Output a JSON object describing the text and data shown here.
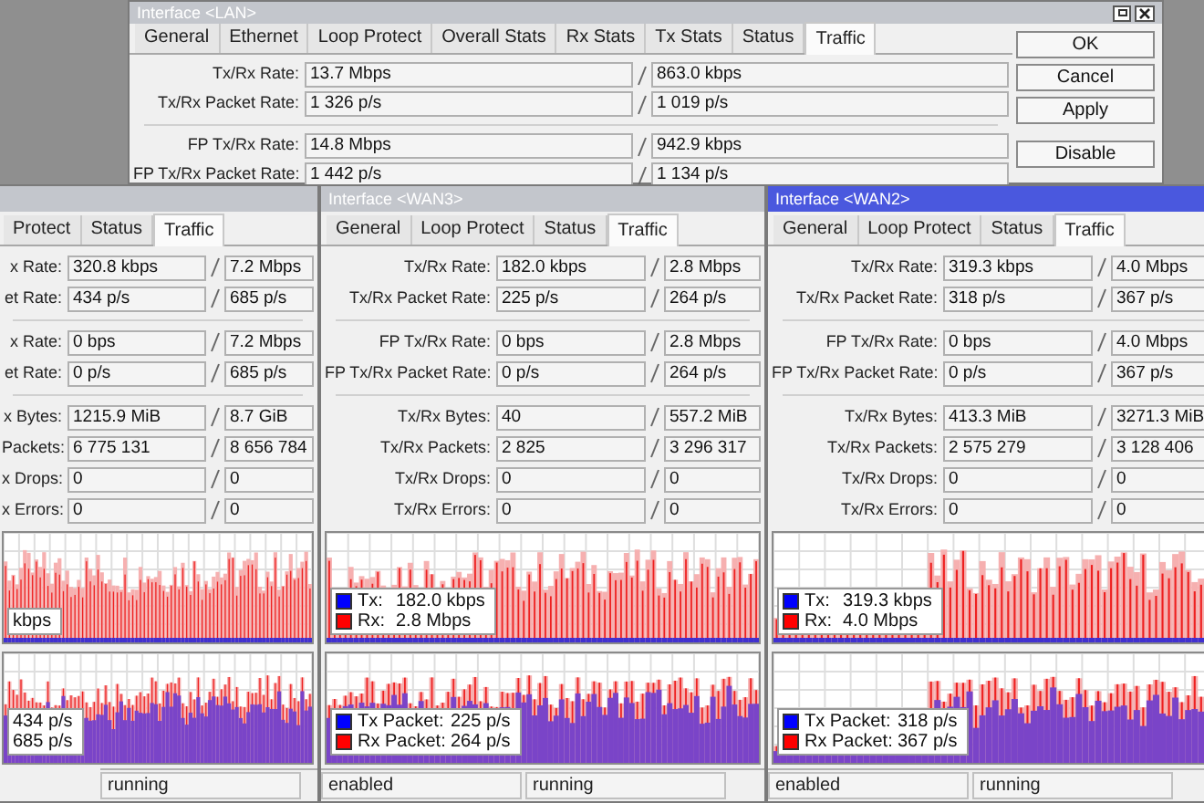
{
  "windows": [
    {
      "title": "Interface <LAN>",
      "active": false,
      "tabs": [
        {
          "label": "General",
          "selected": false
        },
        {
          "label": "Ethernet",
          "selected": false
        },
        {
          "label": "Loop Protect",
          "selected": false
        },
        {
          "label": "Overall Stats",
          "selected": false
        },
        {
          "label": "Rx Stats",
          "selected": false
        },
        {
          "label": "Tx Stats",
          "selected": false
        },
        {
          "label": "Status",
          "selected": false
        },
        {
          "label": "Traffic",
          "selected": true
        }
      ],
      "sections": [
        [
          {
            "label": "Tx/Rx Rate:",
            "tx": "13.7 Mbps",
            "rx": "863.0 kbps"
          },
          {
            "label": "Tx/Rx Packet Rate:",
            "tx": "1 326 p/s",
            "rx": "1 019 p/s"
          }
        ],
        [
          {
            "label": "FP Tx/Rx Rate:",
            "tx": "14.8 Mbps",
            "rx": "942.9 kbps"
          },
          {
            "label": "FP Tx/Rx Packet Rate:",
            "tx": "1 442 p/s",
            "rx": "1 134 p/s"
          }
        ]
      ],
      "buttons": [
        "OK",
        "Cancel",
        "Apply",
        "Disable"
      ]
    },
    {
      "active": false,
      "tabs": [
        {
          "label": "Protect",
          "selected": false
        },
        {
          "label": "Status",
          "selected": false
        },
        {
          "label": "Traffic",
          "selected": true
        }
      ],
      "sections": [
        [
          {
            "label": "x Rate:",
            "tx": "320.8 kbps",
            "rx": "7.2 Mbps"
          },
          {
            "label": "et Rate:",
            "tx": "434 p/s",
            "rx": "685 p/s"
          }
        ],
        [
          {
            "label": "x Rate:",
            "tx": "0 bps",
            "rx": "7.2 Mbps"
          },
          {
            "label": "et Rate:",
            "tx": "0 p/s",
            "rx": "685 p/s"
          }
        ],
        [
          {
            "label": "x Bytes:",
            "tx": "1215.9 MiB",
            "rx": "8.7 GiB"
          },
          {
            "label": "Packets:",
            "tx": "6 775 131",
            "rx": "8 656 784"
          },
          {
            "label": "x Drops:",
            "tx": "0",
            "rx": "0"
          },
          {
            "label": "x Errors:",
            "tx": "0",
            "rx": "0"
          }
        ]
      ],
      "charts": [
        {
          "legend": [
            {
              "value": "kbps"
            }
          ]
        },
        {
          "legend": [
            {
              "value": "434 p/s"
            },
            {
              "value": "685 p/s"
            }
          ]
        }
      ],
      "status": [
        "running"
      ]
    },
    {
      "title": "Interface <WAN3>",
      "active": false,
      "tabs": [
        {
          "label": "General",
          "selected": false
        },
        {
          "label": "Loop Protect",
          "selected": false
        },
        {
          "label": "Status",
          "selected": false
        },
        {
          "label": "Traffic",
          "selected": true
        }
      ],
      "sections": [
        [
          {
            "label": "Tx/Rx Rate:",
            "tx": "182.0 kbps",
            "rx": "2.8 Mbps"
          },
          {
            "label": "Tx/Rx Packet Rate:",
            "tx": "225 p/s",
            "rx": "264 p/s"
          }
        ],
        [
          {
            "label": "FP Tx/Rx Rate:",
            "tx": "0 bps",
            "rx": "2.8 Mbps"
          },
          {
            "label": "FP Tx/Rx Packet Rate:",
            "tx": "0 p/s",
            "rx": "264 p/s"
          }
        ],
        [
          {
            "label": "Tx/Rx Bytes:",
            "tx": "40",
            "rx": "557.2 MiB"
          },
          {
            "label": "Tx/Rx Packets:",
            "tx": "2 825",
            "rx": "3 296 317"
          },
          {
            "label": "Tx/Rx Drops:",
            "tx": "0",
            "rx": "0"
          },
          {
            "label": "Tx/Rx Errors:",
            "tx": "0",
            "rx": "0"
          }
        ]
      ],
      "charts": [
        {
          "legend": [
            {
              "name": "Tx:",
              "value": "182.0 kbps",
              "color": "#0000ff"
            },
            {
              "name": "Rx:",
              "value": "2.8 Mbps",
              "color": "#ff0000"
            }
          ]
        },
        {
          "legend": [
            {
              "name": "Tx Packet:",
              "value": "225 p/s",
              "color": "#0000ff"
            },
            {
              "name": "Rx Packet:",
              "value": "264 p/s",
              "color": "#ff0000"
            }
          ]
        }
      ],
      "status": [
        "enabled",
        "running"
      ]
    },
    {
      "title": "Interface <WAN2>",
      "active": true,
      "tabs": [
        {
          "label": "General",
          "selected": false
        },
        {
          "label": "Loop Protect",
          "selected": false
        },
        {
          "label": "Status",
          "selected": false
        },
        {
          "label": "Traffic",
          "selected": true
        }
      ],
      "sections": [
        [
          {
            "label": "Tx/Rx Rate:",
            "tx": "319.3 kbps",
            "rx": "4.0 Mbps"
          },
          {
            "label": "Tx/Rx Packet Rate:",
            "tx": "318 p/s",
            "rx": "367 p/s"
          }
        ],
        [
          {
            "label": "FP Tx/Rx Rate:",
            "tx": "0 bps",
            "rx": "4.0 Mbps"
          },
          {
            "label": "FP Tx/Rx Packet Rate:",
            "tx": "0 p/s",
            "rx": "367 p/s"
          }
        ],
        [
          {
            "label": "Tx/Rx Bytes:",
            "tx": "413.3 MiB",
            "rx": "3271.3 MiB"
          },
          {
            "label": "Tx/Rx Packets:",
            "tx": "2 575 279",
            "rx": "3 128 406"
          },
          {
            "label": "Tx/Rx Drops:",
            "tx": "0",
            "rx": "0"
          },
          {
            "label": "Tx/Rx Errors:",
            "tx": "0",
            "rx": "0"
          }
        ]
      ],
      "charts": [
        {
          "legend": [
            {
              "name": "Tx:",
              "value": "319.3 kbps",
              "color": "#0000ff"
            },
            {
              "name": "Rx:",
              "value": "4.0 Mbps",
              "color": "#ff0000"
            }
          ]
        },
        {
          "legend": [
            {
              "name": "Tx Packet:",
              "value": "318 p/s",
              "color": "#0000ff"
            },
            {
              "name": "Rx Packet:",
              "value": "367 p/s",
              "color": "#ff0000"
            }
          ]
        }
      ],
      "status": [
        "enabled",
        "running"
      ]
    }
  ]
}
